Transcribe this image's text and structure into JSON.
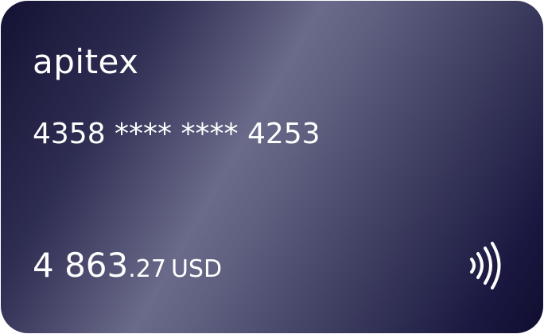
{
  "card": {
    "brand": "apitex",
    "number": "4358 **** **** 4253",
    "balance": {
      "integer": "4 863",
      "fraction": ".27",
      "currency": "USD"
    },
    "icons": {
      "contactless": "contactless-icon"
    },
    "colors": {
      "gradient_dark": "#141233",
      "gradient_light": "#6a6a8a",
      "text": "#ffffff"
    }
  }
}
